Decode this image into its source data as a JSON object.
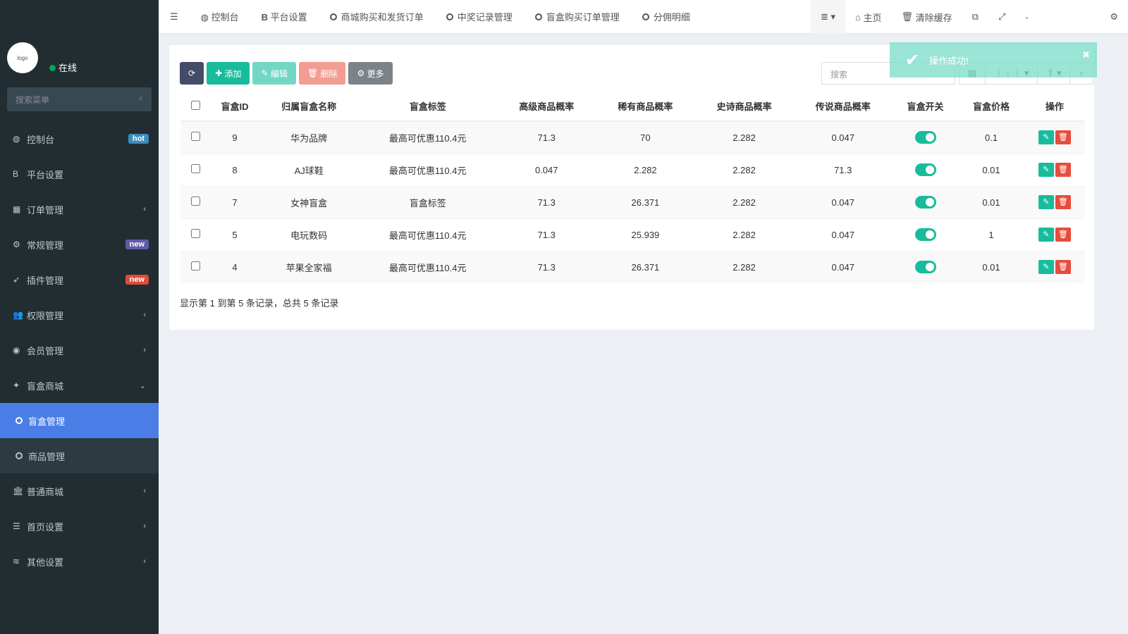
{
  "sidebar": {
    "status": "在线",
    "search_placeholder": "搜索菜单",
    "items": [
      {
        "label": "控制台",
        "icon": "dashboard-icon",
        "badge": "hot",
        "badge_color": "#3c8dbc"
      },
      {
        "label": "平台设置",
        "icon": "bold-b-icon"
      },
      {
        "label": "订单管理",
        "icon": "calculator-icon",
        "arrow": "‹"
      },
      {
        "label": "常规管理",
        "icon": "cogs-icon",
        "badge": "new",
        "badge_color": "#605ca8"
      },
      {
        "label": "插件管理",
        "icon": "rocket-icon",
        "badge": "new",
        "badge_color": "#dd4b39"
      },
      {
        "label": "权限管理",
        "icon": "users-icon",
        "arrow": "‹"
      },
      {
        "label": "会员管理",
        "icon": "user-circle-icon",
        "arrow": "‹"
      },
      {
        "label": "盲盒商城",
        "icon": "magic-icon",
        "arrow": "⌄"
      }
    ],
    "subitems": [
      {
        "label": "盲盒管理"
      },
      {
        "label": "商品管理"
      }
    ],
    "items2": [
      {
        "label": "普通商城",
        "icon": "bank-icon",
        "arrow": "‹"
      },
      {
        "label": "首页设置",
        "icon": "list-icon",
        "arrow": "‹"
      },
      {
        "label": "其他设置",
        "icon": "database-icon",
        "arrow": "‹"
      }
    ]
  },
  "topbar": {
    "tabs": [
      "控制台",
      "平台设置",
      "商城购买和发货订单",
      "中奖记录管理",
      "盲盒购买订单管理",
      "分佣明细"
    ],
    "home": "主页",
    "clear_cache": "清除缓存"
  },
  "toolbar": {
    "add": "添加",
    "edit": "编辑",
    "delete": "删除",
    "more": "更多",
    "search_placeholder": "搜索"
  },
  "toast": {
    "message": "操作成功!"
  },
  "table": {
    "headers": [
      "盲盒ID",
      "归属盲盒名称",
      "盲盒标签",
      "高级商品概率",
      "稀有商品概率",
      "史诗商品概率",
      "传说商品概率",
      "盲盒开关",
      "盲盒价格",
      "操作"
    ],
    "rows": [
      [
        "9",
        "华为品牌",
        "最高可优惠110.4元",
        "71.3",
        "70",
        "2.282",
        "0.047",
        "0.1"
      ],
      [
        "8",
        "AJ球鞋",
        "最高可优惠110.4元",
        "0.047",
        "2.282",
        "2.282",
        "71.3",
        "0.01"
      ],
      [
        "7",
        "女神盲盒",
        "盲盒标签",
        "71.3",
        "26.371",
        "2.282",
        "0.047",
        "0.01"
      ],
      [
        "5",
        "电玩数码",
        "最高可优惠110.4元",
        "71.3",
        "25.939",
        "2.282",
        "0.047",
        "1"
      ],
      [
        "4",
        "苹果全家福",
        "最高可优惠110.4元",
        "71.3",
        "26.371",
        "2.282",
        "0.047",
        "0.01"
      ]
    ]
  },
  "footer": "显示第 1 到第 5 条记录，总共 5 条记录"
}
